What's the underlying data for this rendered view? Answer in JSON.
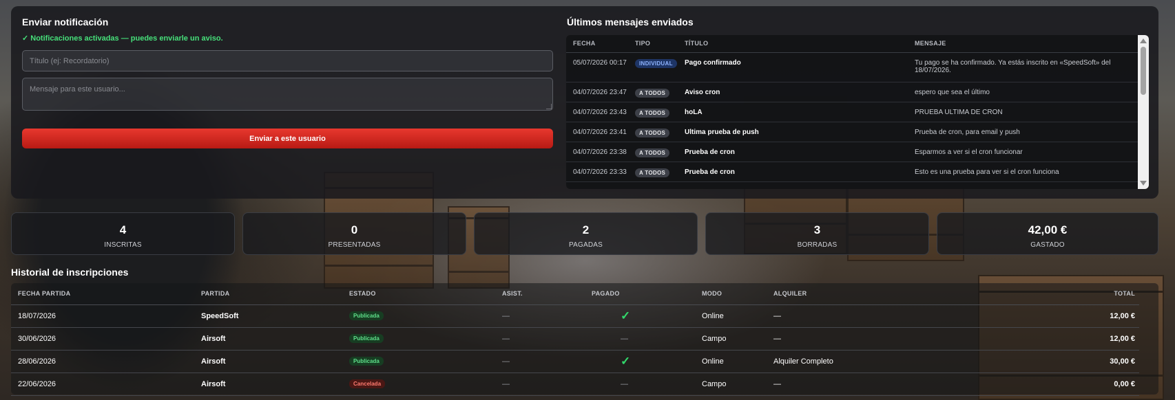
{
  "notify": {
    "title": "Enviar notificación",
    "status": "✓ Notificaciones activadas — puedes enviarle un aviso.",
    "title_placeholder": "Título (ej: Recordatorio)",
    "message_placeholder": "Mensaje para este usuario...",
    "send_label": "Enviar a este usuario"
  },
  "messages": {
    "title": "Últimos mensajes enviados",
    "headers": [
      "FECHA",
      "TIPO",
      "TÍTULO",
      "MENSAJE"
    ],
    "rows": [
      {
        "fecha": "05/07/2026 00:17",
        "tipo": "INDIVIDUAL",
        "titulo": "Pago confirmado",
        "mensaje": "Tu pago se ha confirmado. Ya estás inscrito en «SpeedSoft» del 18/07/2026."
      },
      {
        "fecha": "04/07/2026 23:47",
        "tipo": "A TODOS",
        "titulo": "Aviso cron",
        "mensaje": "espero que sea el último"
      },
      {
        "fecha": "04/07/2026 23:43",
        "tipo": "A TODOS",
        "titulo": "hoLA",
        "mensaje": "PRUEBA ULTIMA DE CRON"
      },
      {
        "fecha": "04/07/2026 23:41",
        "tipo": "A TODOS",
        "titulo": "Ultima prueba de push",
        "mensaje": "Prueba de cron, para email y push"
      },
      {
        "fecha": "04/07/2026 23:38",
        "tipo": "A TODOS",
        "titulo": "Prueba de cron",
        "mensaje": "Esparmos a ver si el cron funcionar"
      },
      {
        "fecha": "04/07/2026 23:33",
        "tipo": "A TODOS",
        "titulo": "Prueba de cron",
        "mensaje": "Esto es una prueba para ver si el cron funciona"
      }
    ]
  },
  "stats": [
    {
      "value": "4",
      "label": "INSCRITAS"
    },
    {
      "value": "0",
      "label": "PRESENTADAS"
    },
    {
      "value": "2",
      "label": "PAGADAS"
    },
    {
      "value": "3",
      "label": "BORRADAS"
    },
    {
      "value": "42,00 €",
      "label": "GASTADO"
    }
  ],
  "history": {
    "title": "Historial de inscripciones",
    "headers": [
      "FECHA PARTIDA",
      "PARTIDA",
      "ESTADO",
      "ASIST.",
      "PAGADO",
      "MODO",
      "ALQUILER",
      "TOTAL"
    ],
    "rows": [
      {
        "fecha": "18/07/2026",
        "partida": "SpeedSoft",
        "estado": "Publicada",
        "asist": "—",
        "pagado": "✓",
        "modo": "Online",
        "alquiler": "—",
        "total": "12,00 €"
      },
      {
        "fecha": "30/06/2026",
        "partida": "Airsoft",
        "estado": "Publicada",
        "asist": "—",
        "pagado": "—",
        "modo": "Campo",
        "alquiler": "—",
        "total": "12,00 €"
      },
      {
        "fecha": "28/06/2026",
        "partida": "Airsoft",
        "estado": "Publicada",
        "asist": "—",
        "pagado": "✓",
        "modo": "Online",
        "alquiler": "Alquiler Completo",
        "total": "30,00 €"
      },
      {
        "fecha": "22/06/2026",
        "partida": "Airsoft",
        "estado": "Cancelada",
        "asist": "—",
        "pagado": "—",
        "modo": "Campo",
        "alquiler": "—",
        "total": "0,00 €"
      }
    ]
  },
  "colors": {
    "accent_red": "#e8382e",
    "success_green": "#46e07a",
    "badge_blue": "#1e3566"
  }
}
